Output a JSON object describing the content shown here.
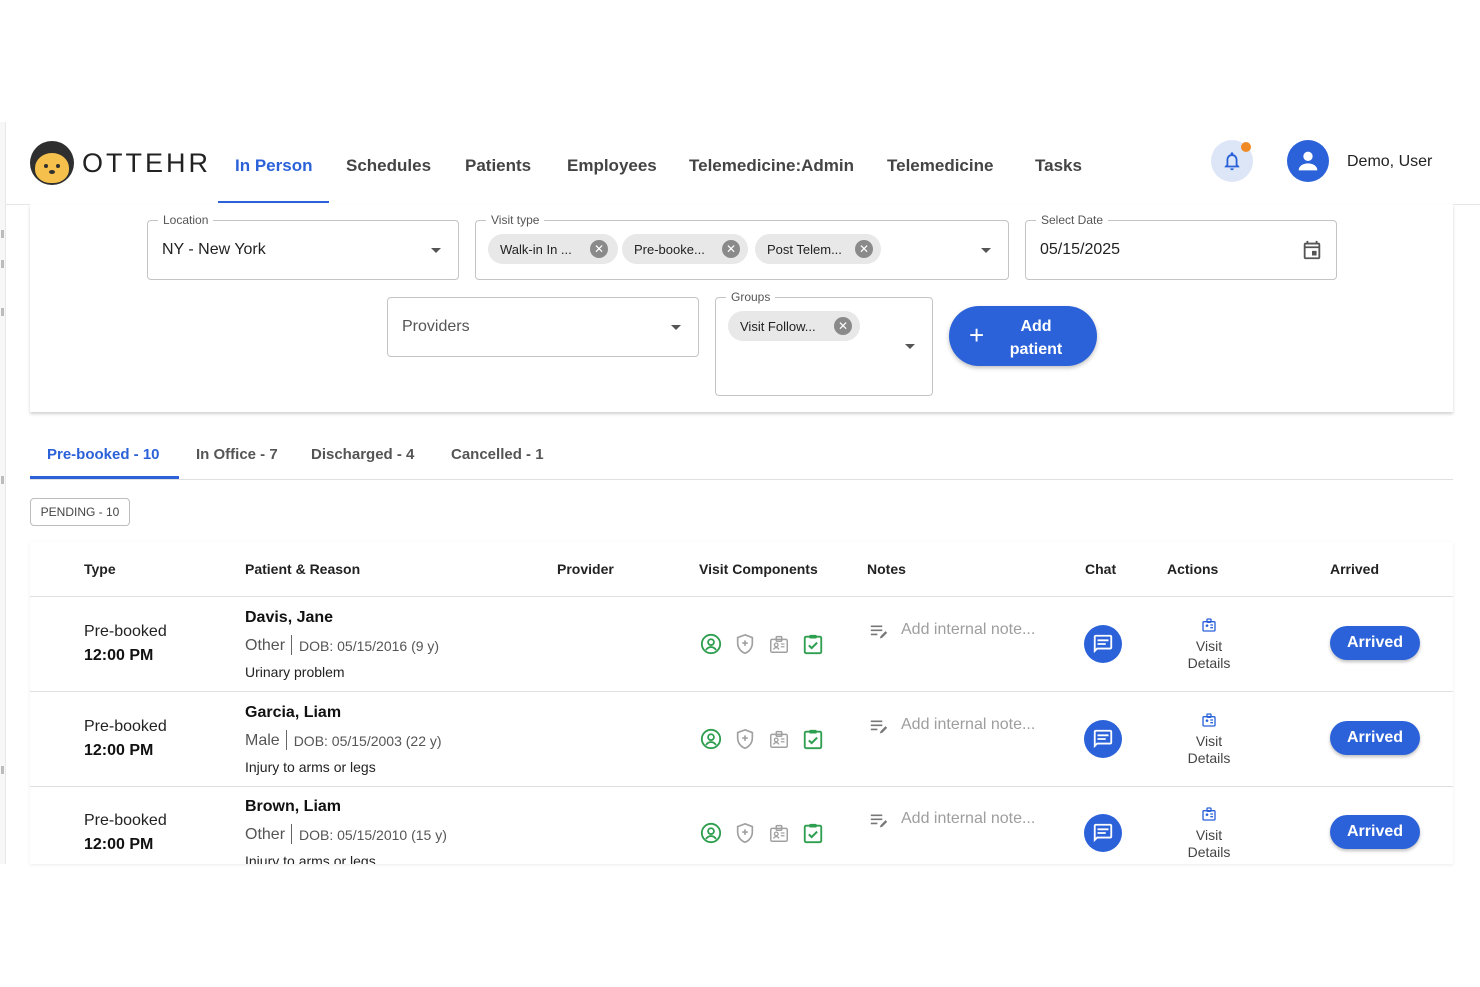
{
  "app": {
    "logo_text": "OTTEHR"
  },
  "nav": {
    "items": [
      {
        "label": "In Person",
        "active": true
      },
      {
        "label": "Schedules"
      },
      {
        "label": "Patients"
      },
      {
        "label": "Employees"
      },
      {
        "label": "Telemedicine:Admin"
      },
      {
        "label": "Telemedicine"
      },
      {
        "label": "Tasks"
      }
    ],
    "user_name": "Demo, User",
    "icons": {
      "notifications": "bell-icon",
      "user": "account-circle-icon"
    },
    "notification_dot_color": "#f08a24"
  },
  "filters": {
    "location": {
      "legend": "Location",
      "value": "NY - New York"
    },
    "visit_type": {
      "legend": "Visit type",
      "chips": [
        "Walk-in In ...",
        "Pre-booke...",
        "Post Telem..."
      ]
    },
    "date": {
      "legend": "Select Date",
      "value": "05/15/2025"
    },
    "providers": {
      "placeholder": "Providers"
    },
    "groups": {
      "legend": "Groups",
      "chips": [
        "Visit Follow..."
      ]
    },
    "add_patient": {
      "plus": "+",
      "label_line1": "Add",
      "label_line2": "patient"
    }
  },
  "tabs": [
    {
      "label": "Pre-booked - 10",
      "active": true
    },
    {
      "label": "In Office - 7"
    },
    {
      "label": "Discharged - 4"
    },
    {
      "label": "Cancelled - 1"
    }
  ],
  "pending_badge": "PENDING - 10",
  "table": {
    "columns": [
      "Type",
      "Patient & Reason",
      "Provider",
      "Visit Components",
      "Notes",
      "Chat",
      "Actions",
      "Arrived"
    ],
    "rows": [
      {
        "type": "Pre-booked",
        "time": "12:00 PM",
        "name": "Davis, Jane",
        "gender": "Other",
        "dob": "DOB: 05/15/2016 (9 y)",
        "reason": "Urinary problem",
        "note_placeholder": "Add internal note...",
        "action_line1": "Visit",
        "action_line2": "Details",
        "arrived_label": "Arrived"
      },
      {
        "type": "Pre-booked",
        "time": "12:00 PM",
        "name": "Garcia, Liam",
        "gender": "Male",
        "dob": "DOB: 05/15/2003 (22 y)",
        "reason": "Injury to arms or legs",
        "note_placeholder": "Add internal note...",
        "action_line1": "Visit",
        "action_line2": "Details",
        "arrived_label": "Arrived"
      },
      {
        "type": "Pre-booked",
        "time": "12:00 PM",
        "name": "Brown, Liam",
        "gender": "Other",
        "dob": "DOB: 05/15/2010 (15 y)",
        "reason": "Injury to arms or legs",
        "note_placeholder": "Add internal note...",
        "action_line1": "Visit",
        "action_line2": "Details",
        "arrived_label": "Arrived"
      }
    ],
    "visit_component_icons": [
      "person-check-icon",
      "insurance-shield-icon",
      "id-card-icon",
      "checklist-icon"
    ]
  },
  "colors": {
    "accent": "#2b62d9",
    "success": "#2e9e4f",
    "muted_icon": "#a0a0a0"
  }
}
